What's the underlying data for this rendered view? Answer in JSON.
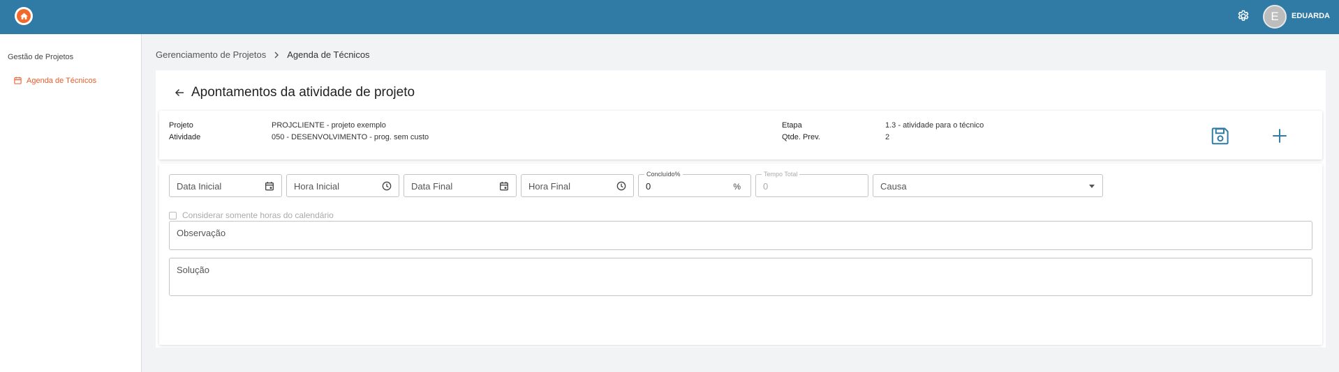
{
  "header": {
    "user_initial": "E",
    "user_name": "EDUARDA",
    "brand_color": "#2f7ba5",
    "accent_color": "#ef5a24"
  },
  "sidebar": {
    "section_title": "Gestão de Projetos",
    "items": [
      {
        "label": "Agenda de Técnicos",
        "icon": "calendar-icon"
      }
    ]
  },
  "breadcrumb": [
    "Gerenciamento de Projetos",
    "Agenda de Técnicos"
  ],
  "page": {
    "title": "Apontamentos da atividade de projeto"
  },
  "info": {
    "projeto_label": "Projeto",
    "projeto_value": "PROJCLIENTE - projeto exemplo",
    "atividade_label": "Atividade",
    "atividade_value": "050 - DESENVOLVIMENTO - prog. sem custo",
    "etapa_label": "Etapa",
    "etapa_value": "1.3 - atividade para o técnico",
    "qtde_label": "Qtde. Prev.",
    "qtde_value": "2"
  },
  "form": {
    "data_inicial_placeholder": "Data Inicial",
    "hora_inicial_placeholder": "Hora Inicial",
    "data_final_placeholder": "Data Final",
    "hora_final_placeholder": "Hora Final",
    "concluido_label": "Concluído%",
    "concluido_value": "0",
    "concluido_suffix": "%",
    "tempo_total_label": "Tempo Total",
    "tempo_total_value": "0",
    "causa_placeholder": "Causa",
    "checkbox_label": "Considerar somente horas do calendário",
    "checkbox_checked": false,
    "observacao_placeholder": "Observação",
    "solucao_placeholder": "Solução"
  }
}
